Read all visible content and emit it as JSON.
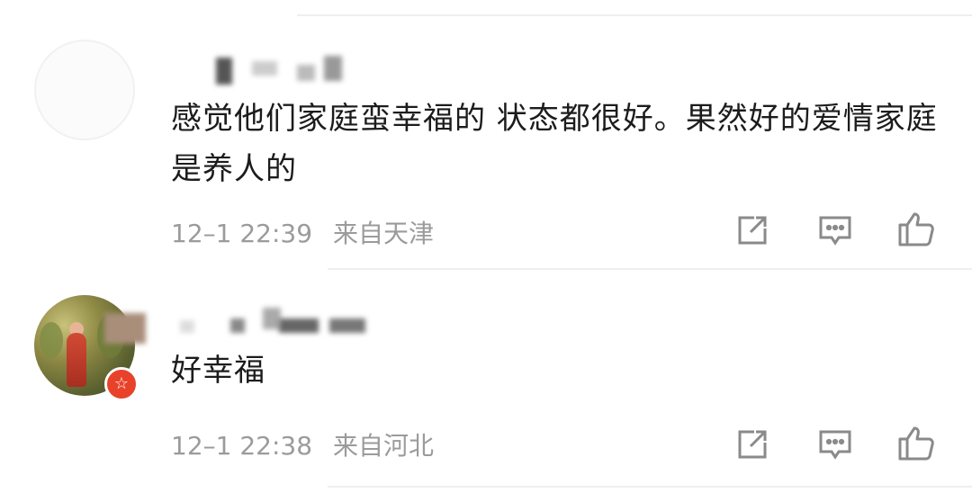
{
  "comments": [
    {
      "text": "感觉他们家庭蛮幸福的 状态都很好。果然好的爱情家庭是养人的",
      "time": "12–1 22:39",
      "location": "来自天津"
    },
    {
      "text": "好幸福",
      "time": "12–1 22:38",
      "location": "来自河北",
      "badge": "☆"
    }
  ],
  "actions": {
    "share_icon": "share-icon",
    "reply_icon": "comment-icon",
    "like_icon": "thumbs-up-icon"
  },
  "colors": {
    "text": "#1c1c1c",
    "meta": "#9b9b9b",
    "badge": "#e8422b",
    "icon": "#8a8a8a",
    "divider": "#efefef"
  }
}
